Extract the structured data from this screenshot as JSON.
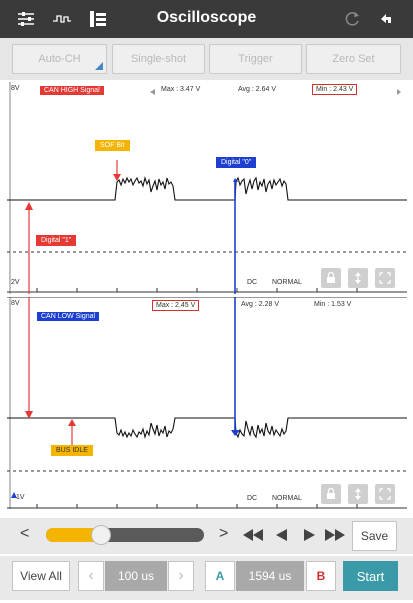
{
  "header": {
    "title": "Oscilloscope",
    "icons": [
      "sliders-icon",
      "waveform-icon",
      "grid-icon",
      "refresh-icon",
      "back-icon"
    ]
  },
  "modes": {
    "auto_ch": "Auto-CH",
    "single_shot": "Single-shot",
    "trigger": "Trigger",
    "zero_set": "Zero Set"
  },
  "channel1": {
    "top_voltage": "8V",
    "bottom_voltage": "2V",
    "signal_label": "CAN HIGH Signal",
    "max": "Max : 3.47 V",
    "avg": "Avg : 2.64 V",
    "min": "Min : 2.43 V",
    "coupling": "DC",
    "mode": "NORMAL",
    "annotation_sof": "SOF Bit",
    "annotation_digital0": "Digital \"0\"",
    "annotation_digital1": "Digital \"1\""
  },
  "channel2": {
    "top_voltage": "8V",
    "bottom_voltage": "1V",
    "signal_label": "CAN LOW Signal",
    "max": "Max : 2.45 V",
    "avg": "Avg : 2.28 V",
    "min": "Min : 1.53 V",
    "coupling": "DC",
    "mode": "NORMAL",
    "annotation_bus_idle": "BUS IDLE"
  },
  "playback": {
    "prev": "<",
    "next": ">",
    "save": "Save",
    "progress": 0.35
  },
  "bottom": {
    "view_all": "View All",
    "timebase": "100 us",
    "cursor_a": "A",
    "cursor_value": "1594 us",
    "cursor_b": "B",
    "start": "Start"
  },
  "colors": {
    "accent": "#3a9aa8",
    "red": "#e53935",
    "blue": "#1e3fcf",
    "yellow": "#f5b400"
  }
}
